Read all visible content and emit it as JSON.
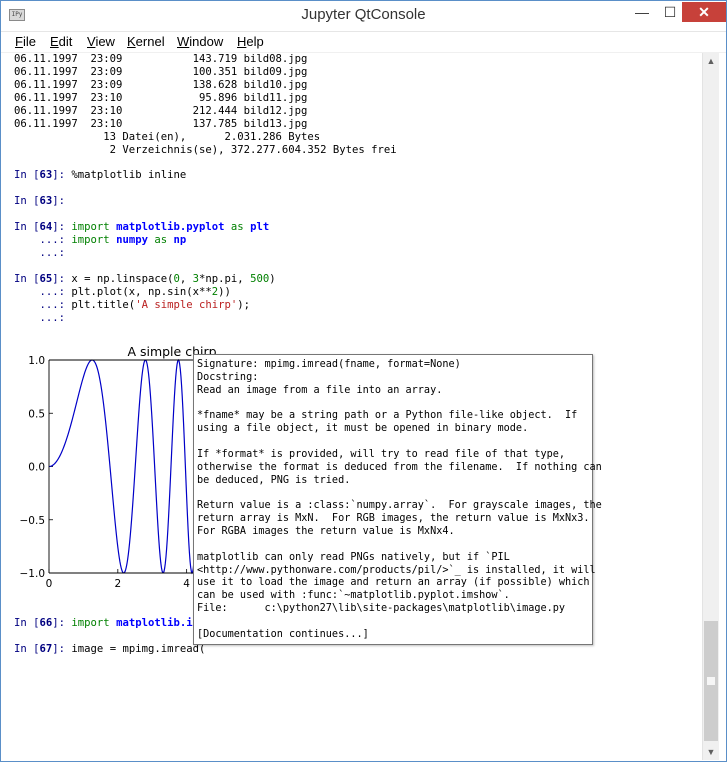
{
  "window": {
    "title": "Jupyter QtConsole",
    "icon_text": "IPy",
    "minimize_glyph": "—",
    "maximize_glyph": "☐",
    "close_glyph": "✕"
  },
  "menu": {
    "file": {
      "accel": "F",
      "rest": "ile"
    },
    "edit": {
      "accel": "E",
      "rest": "dit"
    },
    "view": {
      "accel": "V",
      "rest": "iew"
    },
    "kernel": {
      "accel": "K",
      "rest": "ernel"
    },
    "window": {
      "accel": "W",
      "rest": "indow"
    },
    "help": {
      "accel": "H",
      "rest": "elp"
    }
  },
  "output": {
    "listing": [
      "06.11.1997  23:09           143.719 bild08.jpg",
      "06.11.1997  23:09           100.351 bild09.jpg",
      "06.11.1997  23:09           138.628 bild10.jpg",
      "06.11.1997  23:10            95.896 bild11.jpg",
      "06.11.1997  23:10           212.444 bild12.jpg",
      "06.11.1997  23:10           137.785 bild13.jpg",
      "              13 Datei(en),      2.031.286 Bytes",
      "               2 Verzeichnis(se), 372.277.604.352 Bytes frei"
    ]
  },
  "cells": {
    "c63a": {
      "prompt": "In [",
      "num": "63",
      "end": "]: ",
      "code": "%matplotlib inline"
    },
    "c63b": {
      "prompt": "In [",
      "num": "63",
      "end": "]: "
    },
    "c64": {
      "prompt": "In [",
      "num": "64",
      "end": "]: ",
      "l1": {
        "kw1": "import",
        "mod": "matplotlib.pyplot",
        "kw2": "as",
        "alias": "plt"
      },
      "cont": "    ...: ",
      "l2": {
        "kw1": "import",
        "mod": "numpy",
        "kw2": "as",
        "alias": "np"
      },
      "cont_empty": "    ...:"
    },
    "c65": {
      "prompt": "In [",
      "num": "65",
      "end": "]: ",
      "l1": {
        "a": "x = np.linspace(",
        "n1": "0",
        "b": ", ",
        "n2": "3",
        "c": "*np.pi, ",
        "n3": "500",
        "d": ")"
      },
      "cont": "    ...: ",
      "l2": {
        "a": "plt.plot(x, np.sin(x**",
        "n1": "2",
        "b": "))"
      },
      "l3": {
        "a": "plt.title(",
        "s": "'A simple chirp'",
        "b": ");"
      },
      "cont_empty": "    ...:"
    },
    "c66": {
      "prompt": "In [",
      "num": "66",
      "end": "]: ",
      "kw": "import",
      "mod": "matplotlib.ima"
    },
    "c67": {
      "prompt": "In [",
      "num": "67",
      "end": "]: ",
      "code": "image = mpimg.imread("
    }
  },
  "chart_data": {
    "type": "line",
    "title": "A simple chirp",
    "function": "sin(x**2)",
    "x_range": [
      0,
      9.42477796
    ],
    "xlim": [
      0,
      9.42477796
    ],
    "ylim": [
      -1.0,
      1.0
    ],
    "x_ticks": [
      "0",
      "2",
      "4"
    ],
    "y_ticks": [
      "1.0",
      "0.5",
      "0.0",
      "−0.5",
      "−1.0"
    ],
    "y_tick_values": [
      1.0,
      0.5,
      0.0,
      -0.5,
      -1.0
    ],
    "x_tick_values": [
      0,
      2,
      4
    ],
    "samples": 500,
    "series": [
      {
        "color": "#0000c8"
      }
    ],
    "grid": false
  },
  "tooltip": {
    "lines": [
      "Signature: mpimg.imread(fname, format=None)",
      "Docstring:",
      "Read an image from a file into an array.",
      "",
      "*fname* may be a string path or a Python file-like object.  If",
      "using a file object, it must be opened in binary mode.",
      "",
      "If *format* is provided, will try to read file of that type,",
      "otherwise the format is deduced from the filename.  If nothing can",
      "be deduced, PNG is tried.",
      "",
      "Return value is a :class:`numpy.array`.  For grayscale images, the",
      "return array is MxN.  For RGB images, the return value is MxNx3.",
      "For RGBA images the return value is MxNx4.",
      "",
      "matplotlib can only read PNGs natively, but if `PIL",
      "<http://www.pythonware.com/products/pil/>`_ is installed, it will",
      "use it to load the image and return an array (if possible) which",
      "can be used with :func:`~matplotlib.pyplot.imshow`.",
      "File:      c:\\python27\\lib\\site-packages\\matplotlib\\image.py",
      "",
      "[Documentation continues...]"
    ]
  },
  "scrollbar": {
    "up_glyph": "▲",
    "down_glyph": "▼"
  }
}
